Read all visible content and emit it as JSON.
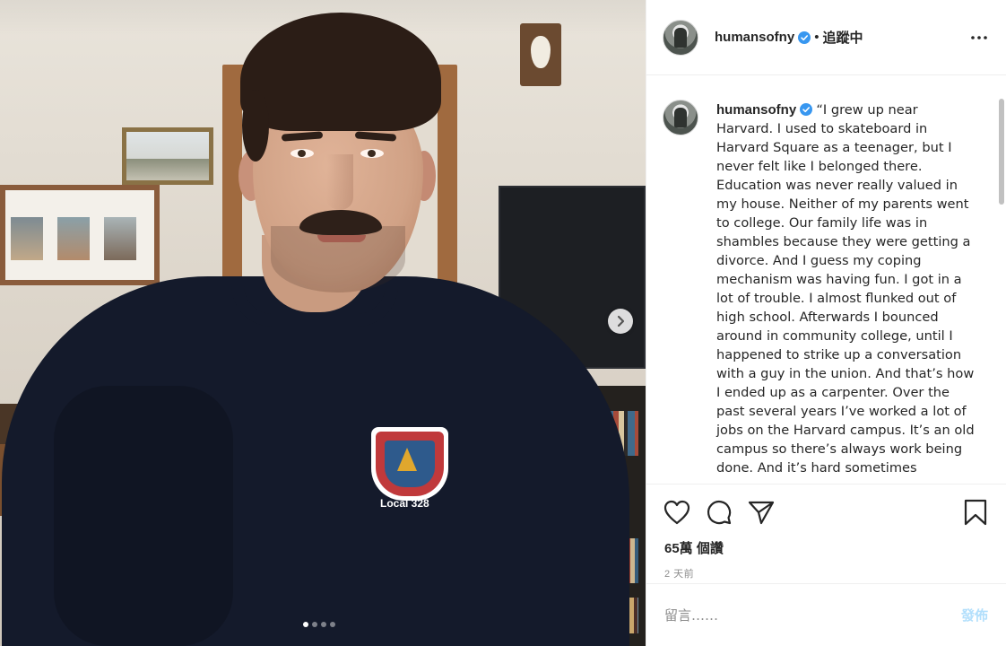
{
  "header": {
    "username": "humansofny",
    "separator": "•",
    "follow_label": "追蹤中"
  },
  "caption": {
    "username": "humansofny",
    "text": "“I grew up near Harvard. I used to skateboard in Harvard Square as a teenager, but I never felt like I belonged there. Education was never really valued in my house. Neither of my parents went to college. Our family life was in shambles because they were getting a divorce. And I guess my coping mechanism was having fun. I got in a lot of trouble. I almost flunked out of high school. Afterwards I bounced around in community college, until I happened to strike up a conversation with a guy in the union. And that’s how I ended up as a carpenter. Over the past several years I’ve worked a lot of jobs on the Harvard campus. It’s an old campus so there’s always work being done. And it’s hard sometimes"
  },
  "photo": {
    "shirt_text": "Local 328",
    "carousel_total": 4,
    "carousel_active": 1
  },
  "actions": {
    "likes": "65萬 個讚",
    "timestamp": "2 天前"
  },
  "comment": {
    "placeholder": "留言……",
    "post_label": "發佈"
  },
  "colors": {
    "verified": "#3897f0",
    "post_disabled": "#b2dffc",
    "text": "#262626",
    "muted": "#8e8e8e"
  },
  "icons": [
    "verified-badge-icon",
    "more-options-icon",
    "chevron-right-icon",
    "heart-icon",
    "comment-icon",
    "share-icon",
    "bookmark-icon"
  ]
}
